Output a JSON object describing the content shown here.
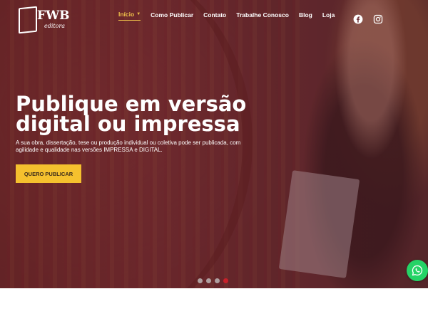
{
  "brand": {
    "logo_text": "FWB",
    "logo_sub": "editora"
  },
  "nav": [
    {
      "label": "Início",
      "active": true,
      "has_dropdown": true
    },
    {
      "label": "Como Publicar",
      "active": false
    },
    {
      "label": "Contato",
      "active": false
    },
    {
      "label": "Trabalhe Conosco",
      "active": false
    },
    {
      "label": "Blog",
      "active": false
    },
    {
      "label": "Loja",
      "active": false
    }
  ],
  "social": [
    {
      "icon": "facebook-icon"
    },
    {
      "icon": "instagram-icon"
    }
  ],
  "hero": {
    "headline": "Publique em versão digital ou impressa",
    "subtext": "A sua obra, dissertação, tese ou produção individual ou coletiva pode ser publicada, com agilidade e qualidade nas versões IMPRESSA e DIGITAL.",
    "cta_label": "QUERO PUBLICAR"
  },
  "slider": {
    "count": 4,
    "active_index": 4
  },
  "colors": {
    "accent": "#f5c12e",
    "nav_active": "#f0c24a",
    "dot_active": "#c8202a",
    "whatsapp": "#25d366"
  }
}
